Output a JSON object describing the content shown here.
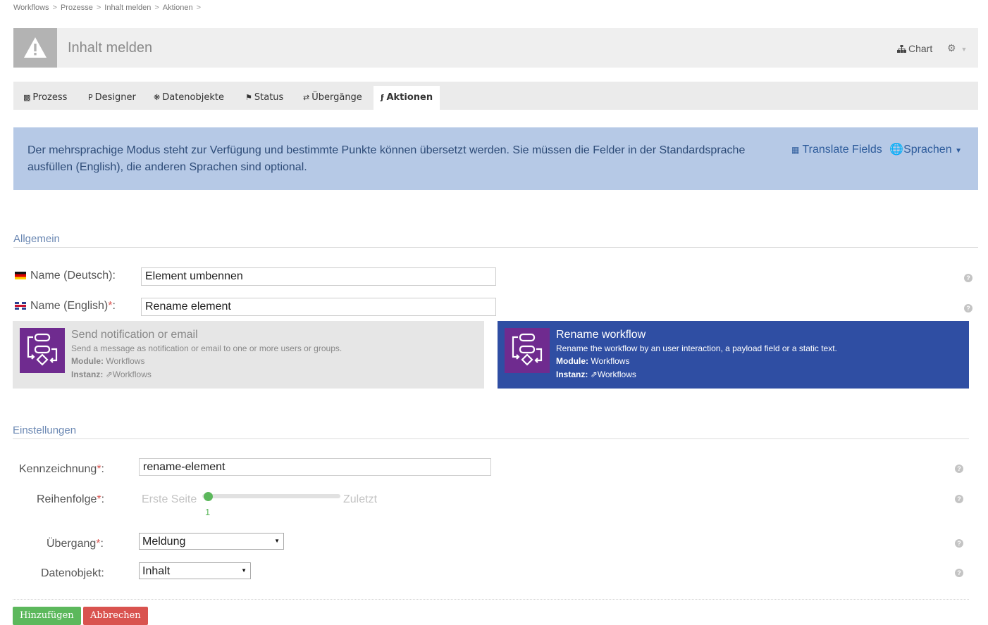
{
  "breadcrumb": [
    "Workflows",
    "Prozesse",
    "Inhalt melden",
    "Aktionen"
  ],
  "header": {
    "title": "Inhalt melden",
    "chart_label": "Chart",
    "icon": "warning-icon"
  },
  "tabs": [
    {
      "label": "Prozess",
      "icon": "sitemap-icon",
      "active": false
    },
    {
      "label": "Designer",
      "icon": "designer-icon",
      "active": false
    },
    {
      "label": "Datenobjekte",
      "icon": "cubes-icon",
      "active": false
    },
    {
      "label": "Status",
      "icon": "flag-icon",
      "active": false
    },
    {
      "label": "Übergänge",
      "icon": "exchange-icon",
      "active": false
    },
    {
      "label": "Aktionen",
      "icon": "bolt-icon",
      "active": true
    }
  ],
  "info": {
    "text": "Der mehrsprachige Modus steht zur Verfügung und bestimmte Punkte können übersetzt werden. Sie müssen die Felder in der Standardsprache ausfüllen (English), die anderen Sprachen sind optional.",
    "translate_label": "Translate Fields",
    "languages_label": "Sprachen"
  },
  "general": {
    "section_title": "Allgemein",
    "name_de_label": "Name (Deutsch):",
    "name_de_value": "Element umbennen",
    "name_en_label": "Name (English)",
    "name_en_value": "Rename element",
    "required_mark": "*",
    "colon": ":"
  },
  "cards": [
    {
      "title": "Send notification or email",
      "description": "Send a message as notification or email to one or more users or groups.",
      "module_label": "Module:",
      "module_value": "Workflows",
      "instance_label": "Instanz:",
      "instance_value": "Workflows",
      "selected": false
    },
    {
      "title": "Rename workflow",
      "description": "Rename the workflow by an user interaction, a payload field or a static text.",
      "module_label": "Module:",
      "module_value": "Workflows",
      "instance_label": "Instanz:",
      "instance_value": "Workflows",
      "selected": true
    }
  ],
  "settings": {
    "section_title": "Einstellungen",
    "key_label": "Kennzeichnung",
    "key_value": "rename-element",
    "order_label": "Reihenfolge",
    "order_min_label": "Erste Seite",
    "order_max_label": "Zuletzt",
    "order_value": "1",
    "transition_label": "Übergang",
    "transition_value": "Meldung",
    "dataobject_label": "Datenobjekt:",
    "dataobject_value": "Inhalt"
  },
  "buttons": {
    "add_label": "Hinzufügen",
    "cancel_label": "Abbrechen"
  },
  "colors": {
    "accent_blue": "#2f4ea3",
    "card_icon_purple": "#6f2b8f",
    "success_green": "#5cb85c",
    "danger_red": "#d9534f",
    "info_bg": "#b6c9e6"
  }
}
